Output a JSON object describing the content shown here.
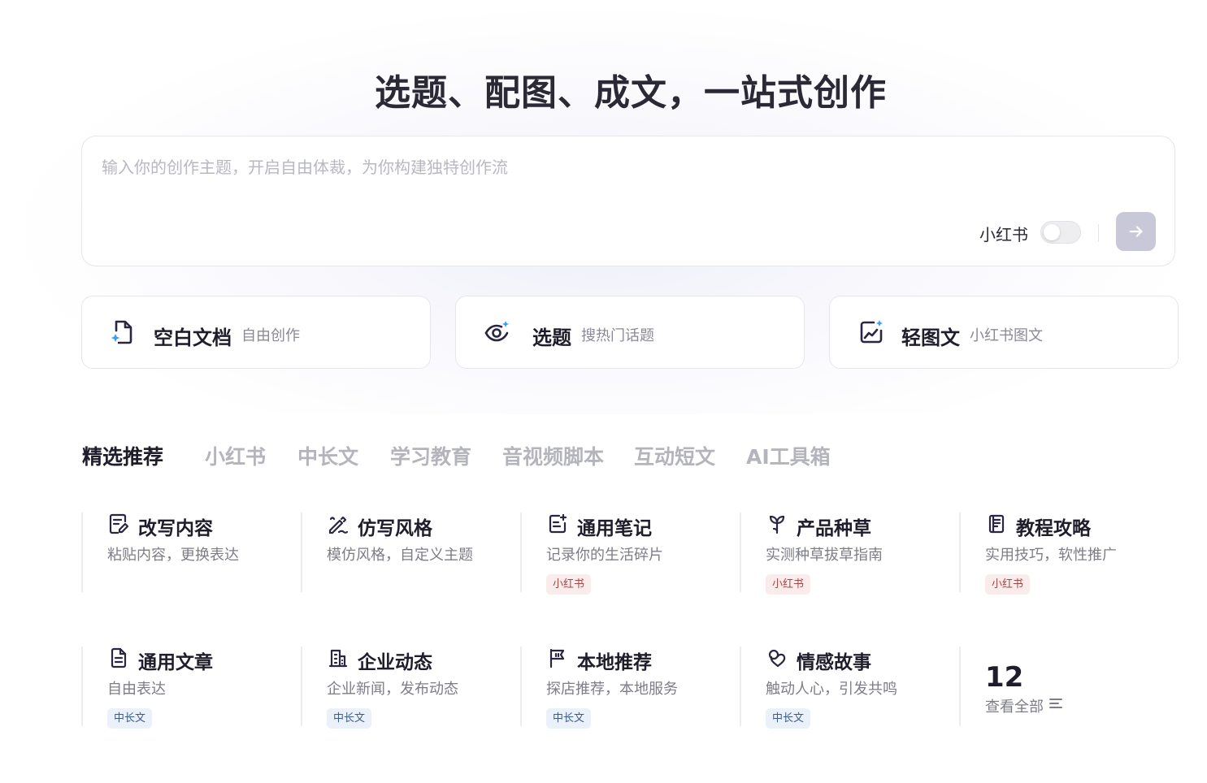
{
  "hero": {
    "title": "选题、配图、成文，一站式创作"
  },
  "prompt": {
    "placeholder": "输入你的创作主题，开启自由体裁，为你构建独特创作流",
    "toggle_label": "小红书",
    "toggle_on": false
  },
  "modes": [
    {
      "title": "空白文档",
      "subtitle": "自由创作",
      "icon": "blank-doc-icon"
    },
    {
      "title": "选题",
      "subtitle": "搜热门话题",
      "icon": "eye-sparkle-icon"
    },
    {
      "title": "轻图文",
      "subtitle": "小红书图文",
      "icon": "chart-sparkle-icon"
    }
  ],
  "categories": [
    "精选推荐",
    "小红书",
    "中长文",
    "学习教育",
    "音视频脚本",
    "互动短文",
    "AI工具箱"
  ],
  "active_category": "精选推荐",
  "templates": [
    {
      "title": "改写内容",
      "desc": "粘贴内容，更换表达",
      "tag": "",
      "icon": "edit-doc-icon"
    },
    {
      "title": "仿写风格",
      "desc": "模仿风格，自定义主题",
      "tag": "",
      "icon": "pen-style-icon"
    },
    {
      "title": "通用笔记",
      "desc": "记录你的生活碎片",
      "tag": "小红书",
      "icon": "note-add-icon"
    },
    {
      "title": "产品种草",
      "desc": "实测种草拔草指南",
      "tag": "小红书",
      "icon": "sprout-icon"
    },
    {
      "title": "教程攻略",
      "desc": "实用技巧，软性推广",
      "tag": "小红书",
      "icon": "guide-book-icon"
    },
    {
      "title": "通用文章",
      "desc": "自由表达",
      "tag": "中长文",
      "icon": "article-icon"
    },
    {
      "title": "企业动态",
      "desc": "企业新闻，发布动态",
      "tag": "中长文",
      "icon": "building-icon"
    },
    {
      "title": "本地推荐",
      "desc": "探店推荐，本地服务",
      "tag": "中长文",
      "icon": "flag-icon"
    },
    {
      "title": "情感故事",
      "desc": "触动人心，引发共鸣",
      "tag": "中长文",
      "icon": "heart-story-icon"
    }
  ],
  "more": {
    "count": "12",
    "label": "查看全部"
  },
  "colors": {
    "accent_dark": "#2b2541",
    "sparkle_blue": "#3aa0f5",
    "tag_red_bg": "#fbecec",
    "tag_blue_bg": "#eaf1fb",
    "send_button": "#c8c8d8"
  }
}
